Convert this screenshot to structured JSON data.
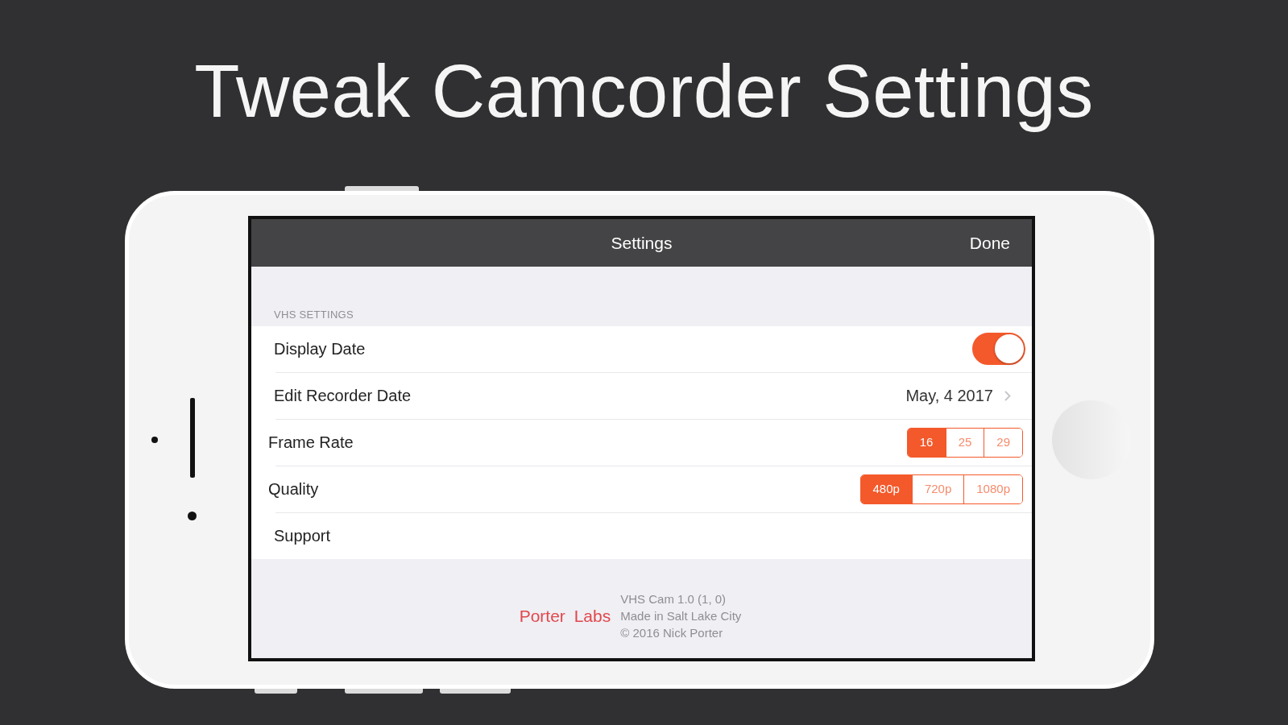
{
  "heading": "Tweak Camcorder Settings",
  "nav": {
    "title": "Settings",
    "action": "Done"
  },
  "section": {
    "header": "VHS SETTINGS",
    "rows": [
      {
        "kind": "switch",
        "label": "Display Date",
        "on": true
      },
      {
        "kind": "disclosure",
        "label": "Edit Recorder Date",
        "value": "May, 4 2017"
      },
      {
        "kind": "segmented",
        "label": "Frame Rate",
        "segments": [
          {
            "label": "16",
            "selected": true
          },
          {
            "label": "25",
            "selected": false
          },
          {
            "label": "29",
            "selected": false
          }
        ]
      },
      {
        "kind": "segmented",
        "label": "Quality",
        "segments": [
          {
            "label": "480p",
            "selected": true
          },
          {
            "label": "720p",
            "selected": false
          },
          {
            "label": "1080p",
            "selected": false
          }
        ]
      },
      {
        "kind": "link",
        "label": "Support"
      }
    ]
  },
  "footer": {
    "logo": "Porter Labs",
    "lines": [
      "VHS Cam 1.0 (1, 0)",
      "Made in Salt Lake City",
      "© 2016 Nick Porter"
    ]
  }
}
